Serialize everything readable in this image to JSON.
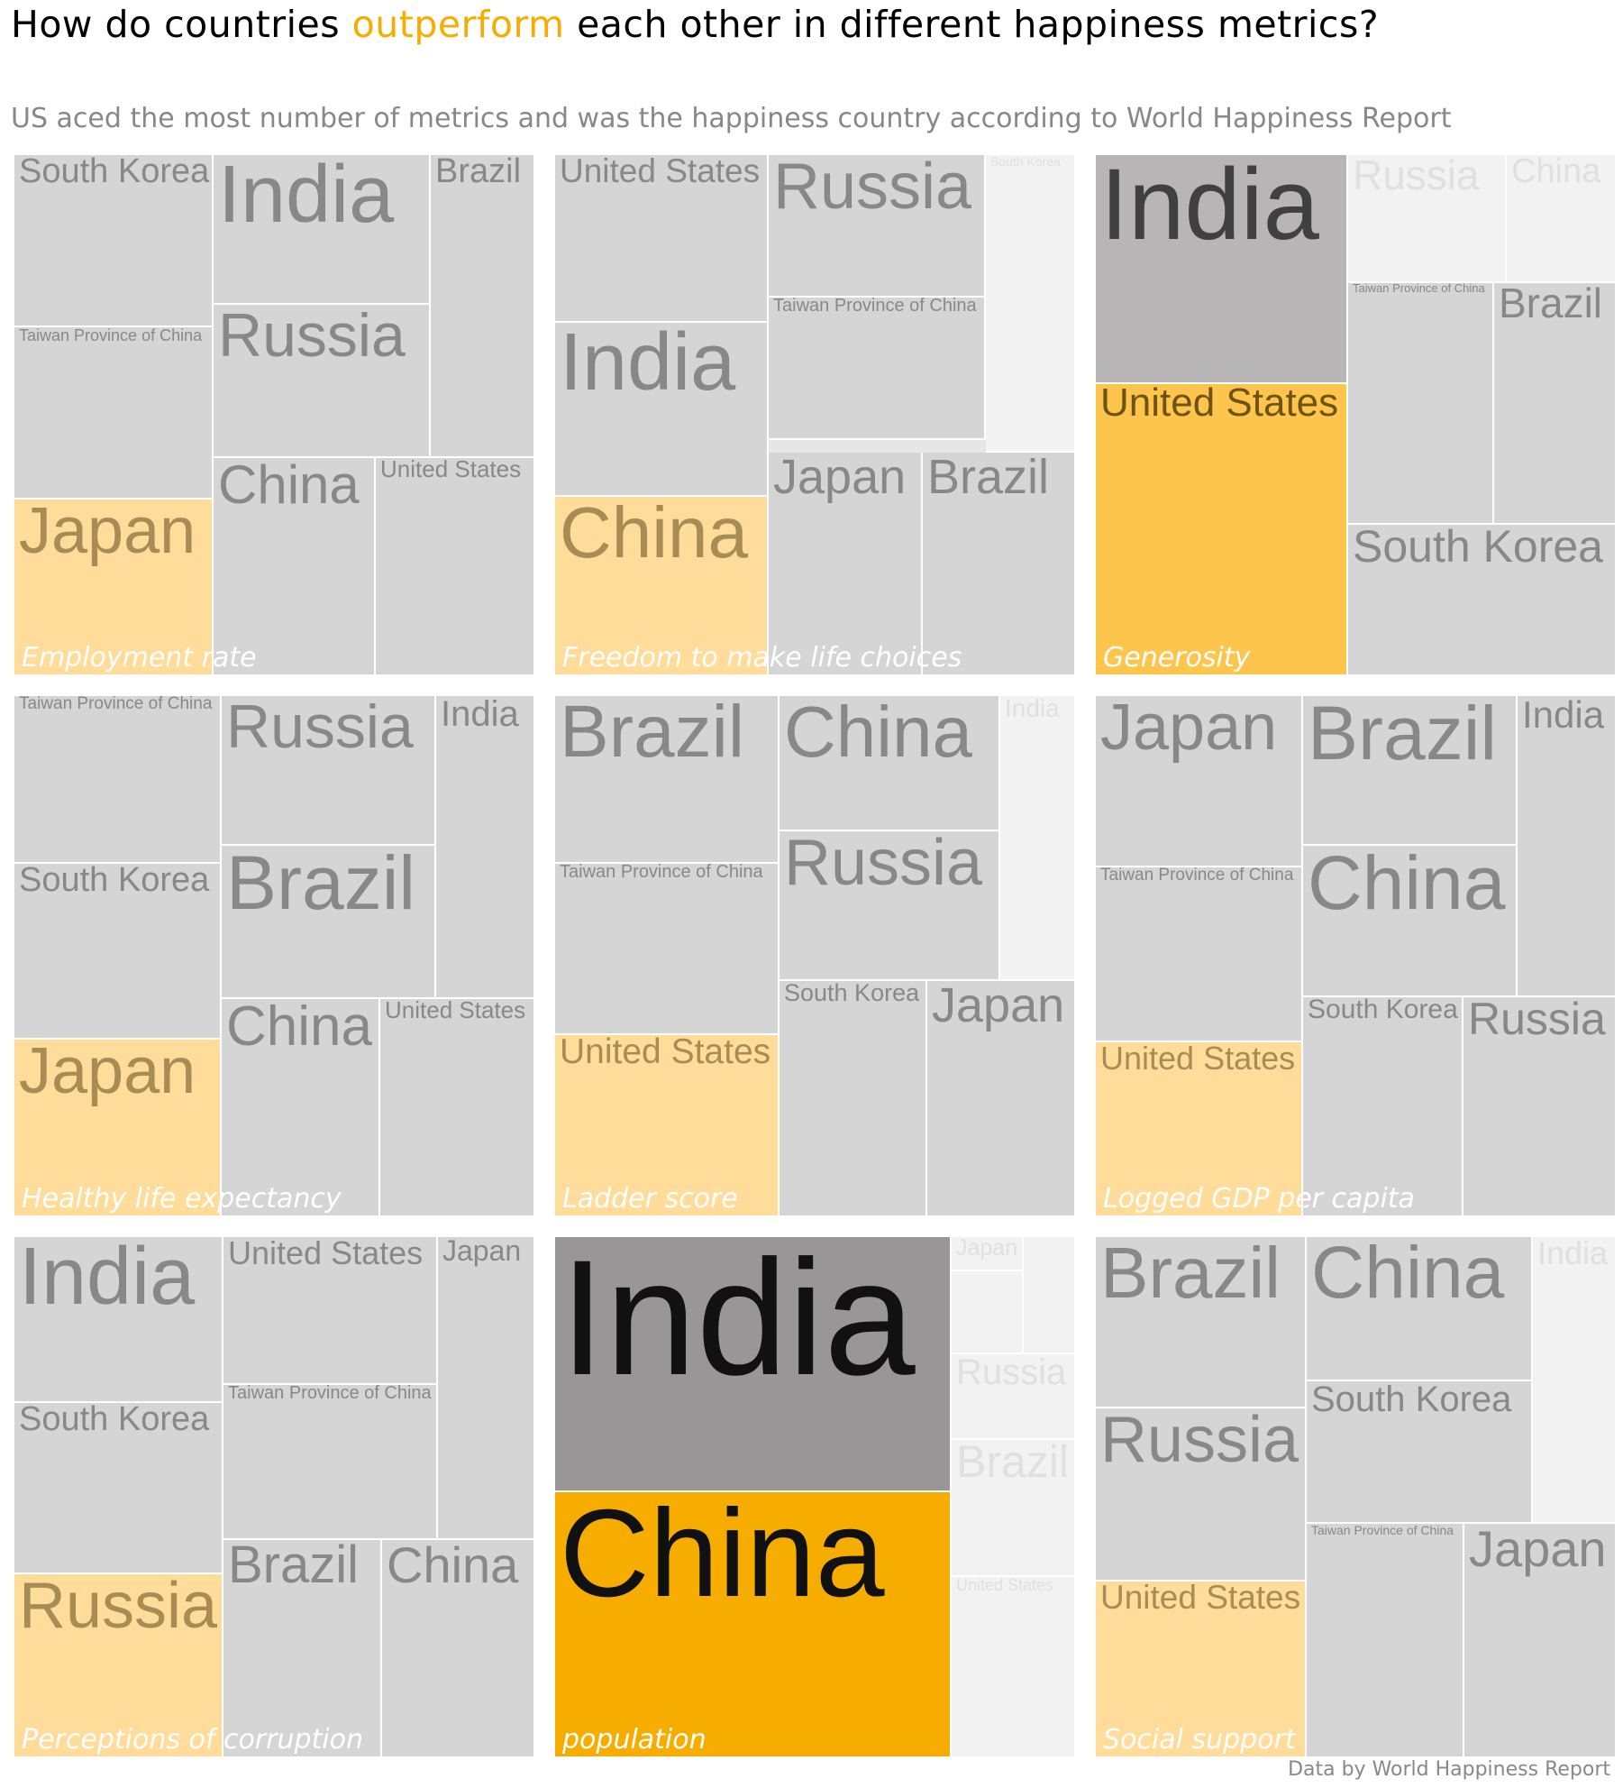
{
  "title": {
    "before": "How do countries ",
    "highlight": "outperform",
    "after": " each other in different happiness metrics?"
  },
  "subtitle": "US aced the most number of metrics and was the happiness country according to World Happiness Report",
  "source": "Data by World Happiness Report",
  "colors": {
    "accent": "#f7ad00",
    "highlight_light": "#ffdc9a",
    "tile_default": "#d6d5d6",
    "tile_faint": "#f2f2f2",
    "text_default": "#888888",
    "text_faint": "#e0e0e0"
  },
  "chart_data": {
    "type": "treemap",
    "panels": [
      {
        "metric": "Employment rate",
        "tiles": [
          {
            "label": "South Korea",
            "style": "default"
          },
          {
            "label": "Taiwan Province of China",
            "style": "default"
          },
          {
            "label": "Japan",
            "style": "highlight"
          },
          {
            "label": "India",
            "style": "default"
          },
          {
            "label": "Russia",
            "style": "default"
          },
          {
            "label": "Brazil",
            "style": "default"
          },
          {
            "label": "China",
            "style": "default"
          },
          {
            "label": "United States",
            "style": "default"
          }
        ]
      },
      {
        "metric": "Freedom to make life choices",
        "tiles": [
          {
            "label": "United States",
            "style": "default"
          },
          {
            "label": "India",
            "style": "default"
          },
          {
            "label": "China",
            "style": "highlight"
          },
          {
            "label": "Russia",
            "style": "default"
          },
          {
            "label": "Taiwan Province of China",
            "style": "default"
          },
          {
            "label": "South Korea",
            "style": "faint"
          },
          {
            "label": "Japan",
            "style": "default"
          },
          {
            "label": "Brazil",
            "style": "default"
          }
        ]
      },
      {
        "metric": "Generosity",
        "tiles": [
          {
            "label": "India",
            "style": "dark"
          },
          {
            "label": "United States",
            "style": "accent"
          },
          {
            "label": "Russia",
            "style": "faint"
          },
          {
            "label": "China",
            "style": "faint"
          },
          {
            "label": "Taiwan Province of China",
            "style": "default"
          },
          {
            "label": "Brazil",
            "style": "default"
          },
          {
            "label": "South Korea",
            "style": "default"
          }
        ]
      },
      {
        "metric": "Healthy life expectancy",
        "tiles": [
          {
            "label": "Taiwan Province of China",
            "style": "default"
          },
          {
            "label": "South Korea",
            "style": "default"
          },
          {
            "label": "Japan",
            "style": "highlight"
          },
          {
            "label": "Russia",
            "style": "default"
          },
          {
            "label": "Brazil",
            "style": "default"
          },
          {
            "label": "India",
            "style": "default"
          },
          {
            "label": "China",
            "style": "default"
          },
          {
            "label": "United States",
            "style": "default"
          }
        ]
      },
      {
        "metric": "Ladder score",
        "tiles": [
          {
            "label": "Brazil",
            "style": "default"
          },
          {
            "label": "Taiwan Province of China",
            "style": "default"
          },
          {
            "label": "United States",
            "style": "highlight"
          },
          {
            "label": "China",
            "style": "default"
          },
          {
            "label": "Russia",
            "style": "default"
          },
          {
            "label": "India",
            "style": "faint"
          },
          {
            "label": "South Korea",
            "style": "default"
          },
          {
            "label": "Japan",
            "style": "default"
          }
        ]
      },
      {
        "metric": "Logged GDP per capita",
        "tiles": [
          {
            "label": "Japan",
            "style": "default"
          },
          {
            "label": "Taiwan Province of China",
            "style": "default"
          },
          {
            "label": "United States",
            "style": "highlight"
          },
          {
            "label": "Brazil",
            "style": "default"
          },
          {
            "label": "China",
            "style": "default"
          },
          {
            "label": "India",
            "style": "default"
          },
          {
            "label": "South Korea",
            "style": "default"
          },
          {
            "label": "Russia",
            "style": "default"
          }
        ]
      },
      {
        "metric": "Perceptions of corruption",
        "tiles": [
          {
            "label": "India",
            "style": "default"
          },
          {
            "label": "South Korea",
            "style": "default"
          },
          {
            "label": "Russia",
            "style": "highlight"
          },
          {
            "label": "United States",
            "style": "default"
          },
          {
            "label": "Taiwan Province of China",
            "style": "default"
          },
          {
            "label": "Japan",
            "style": "default"
          },
          {
            "label": "Brazil",
            "style": "default"
          },
          {
            "label": "China",
            "style": "default"
          }
        ]
      },
      {
        "metric": "population",
        "tiles": [
          {
            "label": "India",
            "style": "darkest"
          },
          {
            "label": "China",
            "style": "accent-strong"
          },
          {
            "label": "Japan",
            "style": "faint"
          },
          {
            "label": "",
            "style": "faint"
          },
          {
            "label": "",
            "style": "faint"
          },
          {
            "label": "Russia",
            "style": "faint"
          },
          {
            "label": "Brazil",
            "style": "faint"
          },
          {
            "label": "United States",
            "style": "faint"
          }
        ]
      },
      {
        "metric": "Social support",
        "tiles": [
          {
            "label": "Brazil",
            "style": "default"
          },
          {
            "label": "Russia",
            "style": "default"
          },
          {
            "label": "United States",
            "style": "highlight"
          },
          {
            "label": "China",
            "style": "default"
          },
          {
            "label": "South Korea",
            "style": "default"
          },
          {
            "label": "India",
            "style": "faint"
          },
          {
            "label": "Taiwan Province of China",
            "style": "default"
          },
          {
            "label": "Japan",
            "style": "default"
          }
        ]
      }
    ]
  }
}
